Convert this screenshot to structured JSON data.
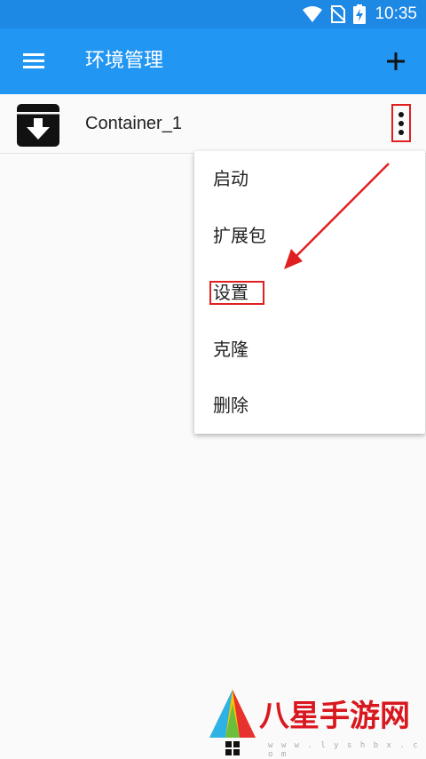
{
  "status_bar": {
    "time": "10:35",
    "icons": [
      "wifi-icon",
      "no-sim-icon",
      "battery-charging-icon"
    ]
  },
  "app_bar": {
    "title": "环境管理",
    "menu_icon": "hamburger-menu-icon",
    "add_icon": "plus-icon"
  },
  "container_list": [
    {
      "name": "Container_1",
      "icon": "archive-download-icon",
      "more_icon": "more-vert-icon"
    }
  ],
  "popup_menu": {
    "items": [
      {
        "label": "启动"
      },
      {
        "label": "扩展包"
      },
      {
        "label": "设置"
      },
      {
        "label": "克隆"
      },
      {
        "label": "删除"
      }
    ]
  },
  "annotations": {
    "highlight_color": "#e02020"
  },
  "watermark": {
    "text": "八星手游网",
    "url": "w w w . l y s h b x . c o m",
    "brand_color": "#d9171e"
  },
  "colors": {
    "primary": "#2196f3",
    "status_bar": "#1e88e5",
    "background": "#fafafa"
  }
}
